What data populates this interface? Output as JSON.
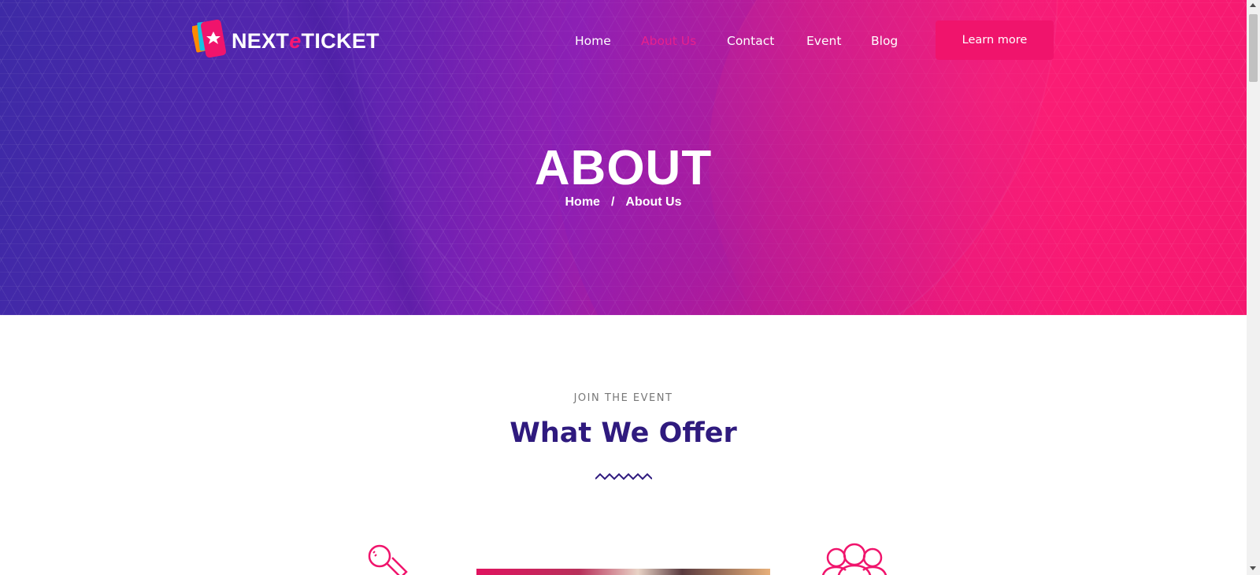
{
  "header": {
    "logo": {
      "text_prefix": "NEXT",
      "text_accent": "e",
      "text_suffix": "TICKET"
    },
    "nav": [
      {
        "label": "Home",
        "active": false
      },
      {
        "label": "About Us",
        "active": true
      },
      {
        "label": "Contact",
        "active": false
      },
      {
        "label": "Event",
        "active": false
      },
      {
        "label": "Blog",
        "active": false
      }
    ],
    "cta_label": "Learn more"
  },
  "hero": {
    "title": "ABOUT",
    "breadcrumb": {
      "home": "Home",
      "separator": "/",
      "current": "About Us"
    }
  },
  "section": {
    "eyebrow": "JOIN THE EVENT",
    "title": "What We Offer"
  },
  "icons": {
    "logo": "ticket-star-icon",
    "divider": "zigzag-divider-icon",
    "feature_left": "microphone-icon",
    "feature_right": "people-group-icon"
  },
  "colors": {
    "accent": "#f0146c",
    "nav_active": "#e8208e",
    "heading": "#2f1a7e",
    "hero_start": "#3d2aa6",
    "hero_end": "#f5186f"
  }
}
